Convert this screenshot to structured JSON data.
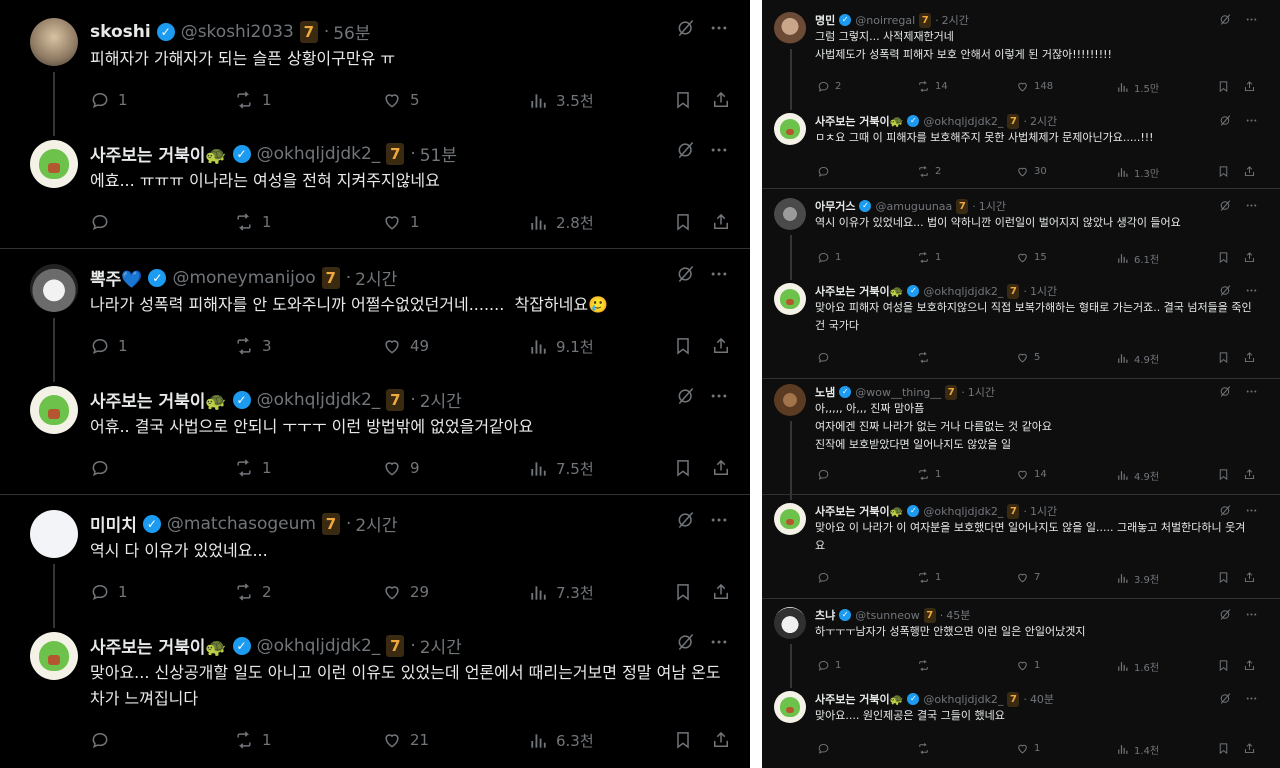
{
  "left": {
    "tweets": [
      {
        "name": "skoshi",
        "handle": "@skoshi2033",
        "badge": "7",
        "time": "56분",
        "text": "피해자가 가해자가 되는 슬픈 상황이구만유 ㅠ",
        "replies": "1",
        "retweets": "1",
        "likes": "5",
        "views": "3.5천"
      },
      {
        "name": "사주보는 거북이🐢",
        "handle": "@okhqljdjdk2_",
        "badge": "7",
        "time": "51분",
        "text": "에효... ㅠㅠㅠ 이나라는 여성을 전혀 지켜주지않네요",
        "replies": "",
        "retweets": "1",
        "likes": "1",
        "views": "2.8천"
      },
      {
        "name": "뽁주💙",
        "handle": "@moneymanijoo",
        "badge": "7",
        "time": "2시간",
        "text": "나라가 성폭력 피해자를 안 도와주니까 어쩔수없었던거네.......  착잡하네요🥲",
        "replies": "1",
        "retweets": "3",
        "likes": "49",
        "views": "9.1천"
      },
      {
        "name": "사주보는 거북이🐢",
        "handle": "@okhqljdjdk2_",
        "badge": "7",
        "time": "2시간",
        "text": "어휴.. 결국 사법으로 안되니 ㅜㅜㅜ 이런 방법밖에 없었을거같아요",
        "replies": "",
        "retweets": "1",
        "likes": "9",
        "views": "7.5천"
      },
      {
        "name": "미미치",
        "handle": "@matchasogeum",
        "badge": "7",
        "time": "2시간",
        "text": "역시 다 이유가 있었네요...",
        "replies": "1",
        "retweets": "2",
        "likes": "29",
        "views": "7.3천"
      },
      {
        "name": "사주보는 거북이🐢",
        "handle": "@okhqljdjdk2_",
        "badge": "7",
        "time": "2시간",
        "text": "맞아요... 신상공개할 일도 아니고 이런 이유도 있었는데 언론에서 때리는거보면 정말 여남 온도차가 느껴집니다",
        "replies": "",
        "retweets": "1",
        "likes": "21",
        "views": "6.3천"
      }
    ]
  },
  "right": {
    "tweets": [
      {
        "name": "명민",
        "handle": "@noirregal",
        "badge": "7",
        "time": "2시간",
        "text": "그럼 그렇지... 사적제재한거네\n사법제도가 성폭력 피해자 보호 안해서 이렇게 된 거잖아!!!!!!!!!",
        "replies": "2",
        "retweets": "14",
        "likes": "148",
        "views": "1.5만"
      },
      {
        "name": "사주보는 거북이🐢",
        "handle": "@okhqljdjdk2_",
        "badge": "7",
        "time": "2시간",
        "text": "ㅁㅊ요 그때 이 피해자를 보호해주지 못한 사법체제가 문제아닌가요.....!!!",
        "replies": "",
        "retweets": "2",
        "likes": "30",
        "views": "1.3만"
      },
      {
        "name": "아무거스",
        "handle": "@amuguunaa",
        "badge": "7",
        "time": "1시간",
        "text": "역시 이유가 있었네요... 법이 약하니깐 이런일이 벌어지지 않았나 생각이 들어요",
        "replies": "1",
        "retweets": "1",
        "likes": "15",
        "views": "6.1천"
      },
      {
        "name": "사주보는 거북이🐢",
        "handle": "@okhqljdjdk2_",
        "badge": "7",
        "time": "1시간",
        "text": "맞아요 피해자 여성을 보호하지않으니 직접 보복가해하는 형태로 가는거죠.. 결국 넘저들을 죽인건 국가다",
        "replies": "",
        "retweets": "",
        "likes": "5",
        "views": "4.9천"
      },
      {
        "name": "노냄",
        "handle": "@wow__thing__",
        "badge": "7",
        "time": "1시간",
        "text": "아,,,,, 아,,, 진짜 맘아픔\n여자에겐 진짜 나라가 없는 거나 다름없는 것 같아요\n진작에 보호받았다면 일어나지도 않았을 일",
        "replies": "",
        "retweets": "1",
        "likes": "14",
        "views": "4.9천"
      },
      {
        "name": "사주보는 거북이🐢",
        "handle": "@okhqljdjdk2_",
        "badge": "7",
        "time": "1시간",
        "text": "맞아요 이 나라가 이 여자분을 보호했다면 일어나지도 않을 일..... 그래놓고 처벌한다하니 웃겨요",
        "replies": "",
        "retweets": "1",
        "likes": "7",
        "views": "3.9천"
      },
      {
        "name": "츠냐",
        "handle": "@tsunneow",
        "badge": "7",
        "time": "45분",
        "text": "하ㅜㅜㅜ남자가 성폭행만 안했으면 이런 일은 안일어났겟지",
        "replies": "1",
        "retweets": "",
        "likes": "1",
        "views": "1.6천"
      },
      {
        "name": "사주보는 거북이🐢",
        "handle": "@okhqljdjdk2_",
        "badge": "7",
        "time": "40분",
        "text": "맞아요.... 원인제공은 결국 그들이 했네요",
        "replies": "",
        "retweets": "",
        "likes": "1",
        "views": "1.4천"
      }
    ]
  },
  "icons": {
    "reply": "reply-icon",
    "retweet": "retweet-icon",
    "like": "heart-icon",
    "views": "views-icon",
    "bookmark": "bookmark-icon",
    "share": "share-icon",
    "grok": "grok-icon",
    "more": "more-icon",
    "verified": "verified-badge-icon"
  },
  "colors": {
    "verified": "#1d9bf0",
    "muted": "#71767b",
    "text": "#e7e9ea",
    "badge": "#f0a93c"
  }
}
